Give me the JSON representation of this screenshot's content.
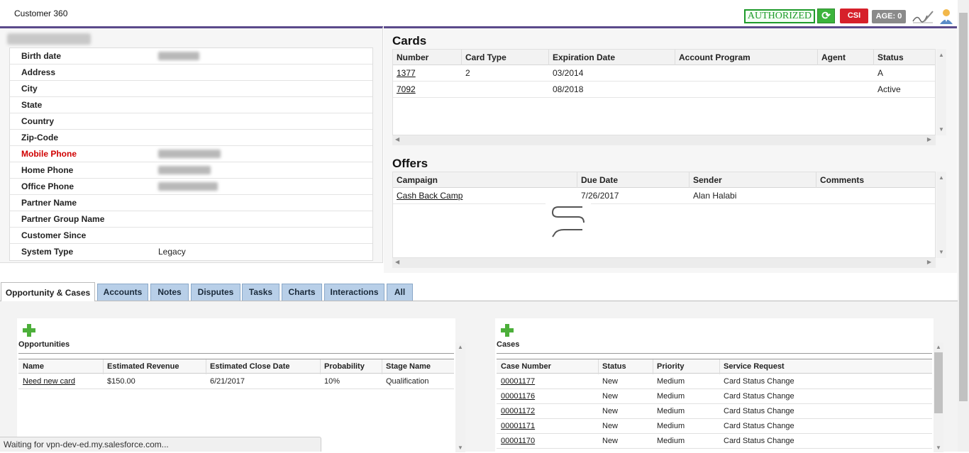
{
  "header": {
    "title": "Customer 360",
    "authorized": "AUTHORIZED",
    "csi": "CSI",
    "age": "AGE: 0"
  },
  "customer": {
    "fields": [
      {
        "label": "Birth date",
        "value": "",
        "blurred": true,
        "red": false
      },
      {
        "label": "Address",
        "value": "",
        "blurred": false,
        "red": false
      },
      {
        "label": "City",
        "value": "",
        "blurred": false,
        "red": false
      },
      {
        "label": "State",
        "value": "",
        "blurred": false,
        "red": false
      },
      {
        "label": "Country",
        "value": "",
        "blurred": false,
        "red": false
      },
      {
        "label": "Zip-Code",
        "value": "",
        "blurred": false,
        "red": false
      },
      {
        "label": "Mobile Phone",
        "value": "",
        "blurred": true,
        "red": true
      },
      {
        "label": "Home Phone",
        "value": "",
        "blurred": true,
        "red": false
      },
      {
        "label": "Office Phone",
        "value": "",
        "blurred": true,
        "red": false
      },
      {
        "label": "Partner Name",
        "value": "",
        "blurred": false,
        "red": false
      },
      {
        "label": "Partner Group Name",
        "value": "",
        "blurred": false,
        "red": false
      },
      {
        "label": "Customer Since",
        "value": "",
        "blurred": false,
        "red": false
      },
      {
        "label": "System Type",
        "value": "Legacy",
        "blurred": false,
        "red": false
      }
    ]
  },
  "cards": {
    "title": "Cards",
    "columns": [
      "Number",
      "Card Type",
      "Expiration Date",
      "Account Program",
      "Agent",
      "Status"
    ],
    "rows": [
      [
        "1377",
        "2",
        "03/2014",
        "",
        "",
        "A"
      ],
      [
        "7092",
        "",
        "08/2018",
        "",
        "",
        "Active"
      ]
    ]
  },
  "offers": {
    "title": "Offers",
    "columns": [
      "Campaign",
      "Due Date",
      "Sender",
      "Comments"
    ],
    "rows": [
      [
        "Cash Back Camp",
        "7/26/2017",
        "Alan Halabi",
        ""
      ]
    ]
  },
  "tabs": [
    "Opportunity & Cases",
    "Accounts",
    "Notes",
    "Disputes",
    "Tasks",
    "Charts",
    "Interactions",
    "All"
  ],
  "opportunities": {
    "title": "Opportunities",
    "columns": [
      "Name",
      "Estimated Revenue",
      "Estimated Close Date",
      "Probability",
      "Stage Name"
    ],
    "rows": [
      [
        "Need new card",
        "$150.00",
        "6/21/2017",
        "10%",
        "Qualification"
      ]
    ]
  },
  "cases": {
    "title": "Cases",
    "columns": [
      "Case Number",
      "Status",
      "Priority",
      "Service Request"
    ],
    "rows": [
      [
        "00001177",
        "New",
        "Medium",
        "Card Status Change"
      ],
      [
        "00001176",
        "New",
        "Medium",
        "Card Status Change"
      ],
      [
        "00001172",
        "New",
        "Medium",
        "Card Status Change"
      ],
      [
        "00001171",
        "New",
        "Medium",
        "Card Status Change"
      ],
      [
        "00001170",
        "New",
        "Medium",
        "Card Status Change"
      ]
    ]
  },
  "status_bar": "Waiting for vpn-dev-ed.my.salesforce.com...",
  "colors": {
    "accent": "#5b4a8b",
    "authorized": "#1e9a2a",
    "csi": "#d6202a",
    "tab": "#b8cfe8"
  }
}
